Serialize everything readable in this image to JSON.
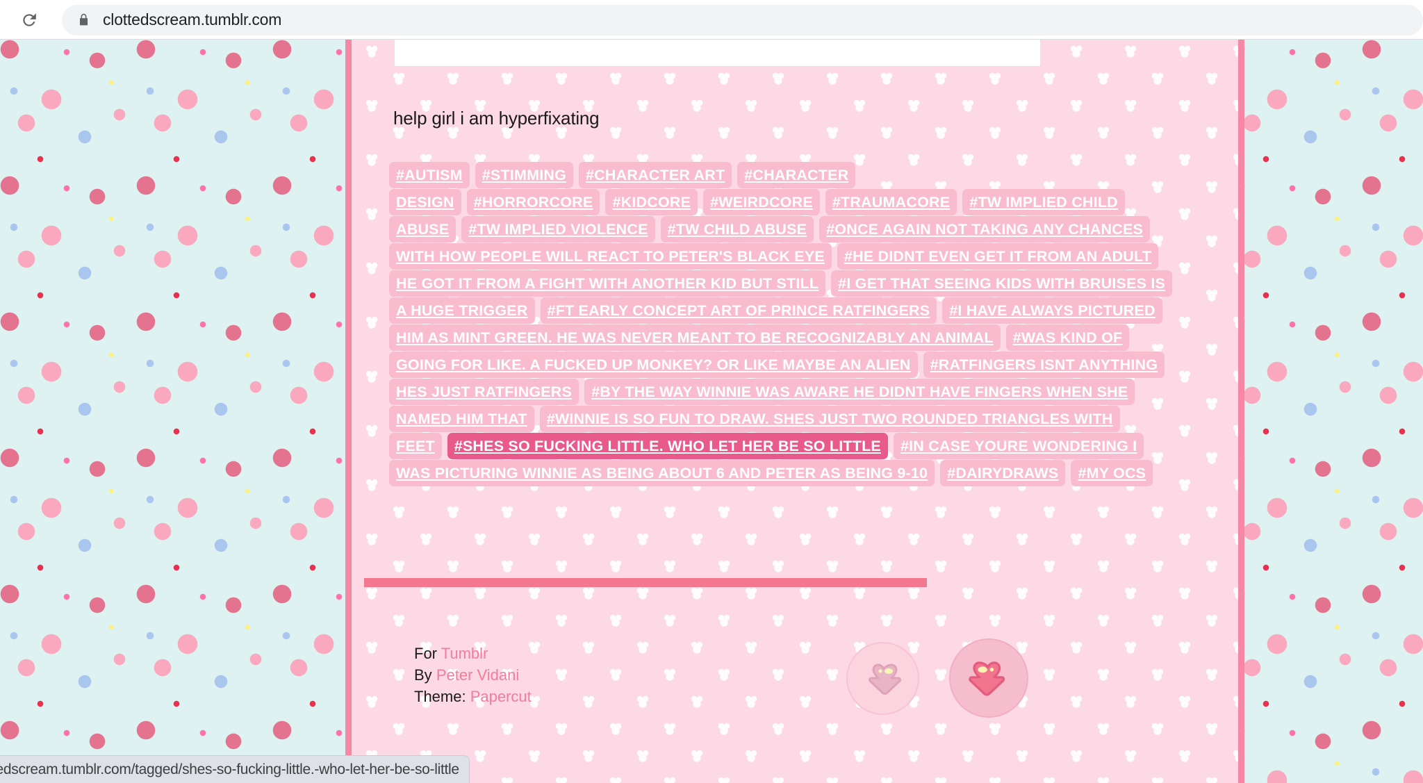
{
  "browser": {
    "reload_icon": "reload-icon",
    "lock_icon": "lock-icon",
    "url": "clottedscream.tumblr.com",
    "status_url": "tedscream.tumblr.com/tagged/shes-so-fucking-little.-who-let-her-be-so-little"
  },
  "post": {
    "caption": "help girl i am hyperfixating",
    "tags": [
      {
        "label": "#AUTISM",
        "active": false
      },
      {
        "label": "#STIMMING",
        "active": false
      },
      {
        "label": "#CHARACTER ART",
        "active": false
      },
      {
        "label": "#CHARACTER DESIGN",
        "active": false
      },
      {
        "label": "#HORRORCORE",
        "active": false
      },
      {
        "label": "#KIDCORE",
        "active": false
      },
      {
        "label": "#WEIRDCORE",
        "active": false
      },
      {
        "label": "#TRAUMACORE",
        "active": false
      },
      {
        "label": "#TW IMPLIED CHILD ABUSE",
        "active": false
      },
      {
        "label": "#TW IMPLIED VIOLENCE",
        "active": false
      },
      {
        "label": "#TW CHILD ABUSE",
        "active": false
      },
      {
        "label": "#ONCE AGAIN NOT TAKING ANY CHANCES WITH HOW PEOPLE WILL REACT TO PETER'S BLACK EYE",
        "active": false
      },
      {
        "label": "#HE DIDNT EVEN GET IT FROM AN ADULT HE GOT IT FROM A FIGHT WITH ANOTHER KID BUT STILL",
        "active": false
      },
      {
        "label": "#I GET THAT SEEING KIDS WITH BRUISES IS A HUGE TRIGGER",
        "active": false
      },
      {
        "label": "#FT EARLY CONCEPT ART OF PRINCE RATFINGERS",
        "active": false
      },
      {
        "label": "#I HAVE ALWAYS PICTURED HIM AS MINT GREEN. HE WAS NEVER MEANT TO BE RECOGNIZABLY AN ANIMAL",
        "active": false
      },
      {
        "label": "#WAS KIND OF GOING FOR LIKE. A FUCKED UP MONKEY? OR LIKE MAYBE AN ALIEN",
        "active": false
      },
      {
        "label": "#RATFINGERS ISNT ANYTHING HES JUST RATFINGERS",
        "active": false
      },
      {
        "label": "#BY THE WAY WINNIE WAS AWARE HE DIDNT HAVE FINGERS WHEN SHE NAMED HIM THAT",
        "active": false
      },
      {
        "label": "#WINNIE IS SO FUN TO DRAW. SHES JUST TWO ROUNDED TRIANGLES WITH FEET",
        "active": false
      },
      {
        "label": "#SHES SO FUCKING LITTLE. WHO LET HER BE SO LITTLE",
        "active": true
      },
      {
        "label": "#IN CASE YOURE WONDERING I WAS PICTURING WINNIE AS BEING ABOUT 6 AND PETER AS BEING 9-10",
        "active": false
      },
      {
        "label": "#DAIRYDRAWS",
        "active": false
      },
      {
        "label": "#MY OCS",
        "active": false
      }
    ]
  },
  "footer": {
    "for_label": "For",
    "for_link": "Tumblr",
    "by_label": "By",
    "by_link": "Peter Vidani",
    "theme_label": "Theme:",
    "theme_link": "Papercut"
  },
  "nav": {
    "prev_icon": "heart-arrow-left-icon",
    "next_icon": "heart-arrow-right-icon",
    "prev_name": "previous-page-button",
    "next_name": "next-page-button"
  },
  "colors": {
    "tag_bg": "#f9bcce",
    "tag_active_bg": "#e85a8a",
    "column_bg": "#fcd9e4",
    "column_border": "#f589a5",
    "divider": "#f2778f",
    "link": "#ef7d9d",
    "wallpaper_bg": "#ddf2f1"
  }
}
